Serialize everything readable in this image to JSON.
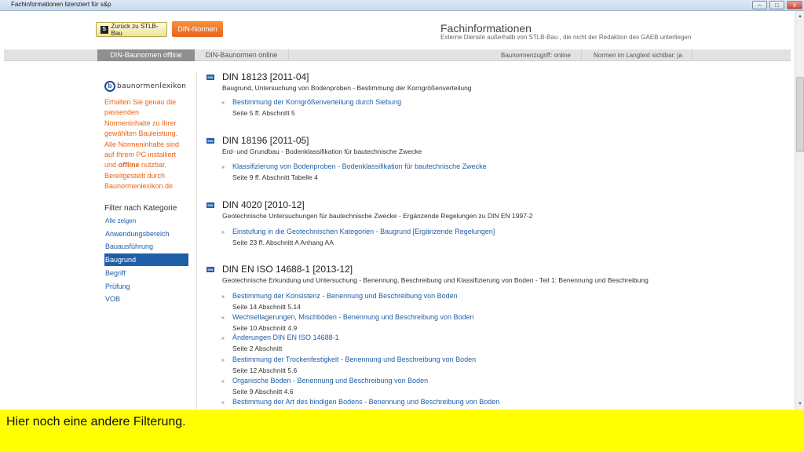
{
  "window": {
    "title": "Fachinformationen lizenziert für s&p",
    "minimize": "–",
    "maximize": "□",
    "close": "x"
  },
  "toolbar": {
    "back_icon": "S",
    "back_label": "Zurück zu STLB-Bau",
    "din_label": "DIN-Normen"
  },
  "header": {
    "title": "Fachinformationen",
    "subtitle": "Externe Dienste außerhalb von  STLB-Bau , die nicht der Redaktion des GAEB unterliegen"
  },
  "tabs": [
    {
      "label": "DIN-Baunormen offline",
      "active": true
    },
    {
      "label": "DIN-Baunormen online",
      "active": false
    }
  ],
  "status": {
    "access": "Baunormenzugriff: online",
    "visible": "Normen im Langtext sichtbar: ja"
  },
  "sidebar": {
    "logo_letter": "b",
    "logo_text": "baunormenlexikon",
    "promo_lines": [
      "Erhalten Sie genau die",
      "passenden",
      "Normeninhalte zu Ihrer",
      "gewählten Bauleistung.",
      "Alle Normeninhalte sind",
      "auf Ihrem PC installiert",
      "und ",
      "offline",
      " nutzbar.",
      "Bereitgestellt durch",
      "Baunormenlexikon.de"
    ],
    "filter_title": "Filter nach Kategorie",
    "filters": [
      {
        "label": "Alle zeigen"
      },
      {
        "label": "Anwendungsbereich"
      },
      {
        "label": "Bauausführung"
      },
      {
        "label": "Baugrund"
      },
      {
        "label": "Begriff"
      },
      {
        "label": "Prüfung"
      },
      {
        "label": "VOB"
      }
    ]
  },
  "entries": [
    {
      "icon": "DIN",
      "title": "DIN 18123 [2011-04]",
      "subtitle": "Baugrund, Untersuchung von Bodenproben - Bestimmung der Korngrößenverteilung",
      "links": [
        {
          "arrow": "»",
          "label": "Bestimmung der Korngrößenverteilung durch Siebung",
          "meta": "Seite 5 ff. Abschnitt 5"
        }
      ]
    },
    {
      "icon": "DIN",
      "title": "DIN 18196 [2011-05]",
      "subtitle": "Erd- und Grundbau - Bodenklassifikation für bautechnische Zwecke",
      "links": [
        {
          "arrow": "»",
          "label": "Klassifizierung von Bodenproben - Bodenklassifikation für bautechnische Zwecke",
          "meta": "Seite 9 ff. Abschnitt Tabelle 4"
        }
      ]
    },
    {
      "icon": "DIN",
      "title": "DIN 4020 [2010-12]",
      "subtitle": "Geotechnische Untersuchungen für bautechnische Zwecke - Ergänzende Regelungen zu DIN EN 1997-2",
      "links": [
        {
          "arrow": "»",
          "label": "Einstufung in die Geotechnischen Kategorien - Baugrund [Ergänzende Regelungen]",
          "meta": "Seite 23 ff. Abschnitt A Anhang AA"
        }
      ]
    },
    {
      "icon": "DIN",
      "title": "DIN EN ISO 14688-1 [2013-12]",
      "subtitle": "Geotechnische Erkundung und Untersuchung - Benennung, Beschreibung und Klassifizierung von Boden - Teil 1: Benennung und Beschreibung",
      "links": [
        {
          "arrow": "»",
          "label": "Bestimmung der Konsistenz - Benennung und Beschreibung von Boden",
          "meta": "Seite 14 Abschnitt 5.14"
        },
        {
          "arrow": "»",
          "label": "Wechsellagerungen, Mischböden - Benennung und Beschreibung von Boden",
          "meta": "Seite 10 Abschnitt 4.9"
        },
        {
          "arrow": "»",
          "label": "Änderungen DIN EN ISO 14688-1",
          "meta": "Seite 2 Abschnitt"
        },
        {
          "arrow": "»",
          "label": "Bestimmung der Trockenfestigkeit - Benennung und Beschreibung von Boden",
          "meta": "Seite 12 Abschnitt 5.6"
        },
        {
          "arrow": "»",
          "label": "Organische Böden - Benennung und Beschreibung von Boden",
          "meta": "Seite 9 Abschnitt 4.6"
        },
        {
          "arrow": "»",
          "label": "Bestimmung der Art des bindigen Bodens - Benennung und Beschreibung von Boden",
          "meta": ""
        }
      ]
    }
  ],
  "banner": {
    "text": "Hier noch eine andere Filterung."
  },
  "colors": {
    "link": "#1f5fa8",
    "accent": "#e8641a",
    "banner": "#ffff00"
  }
}
